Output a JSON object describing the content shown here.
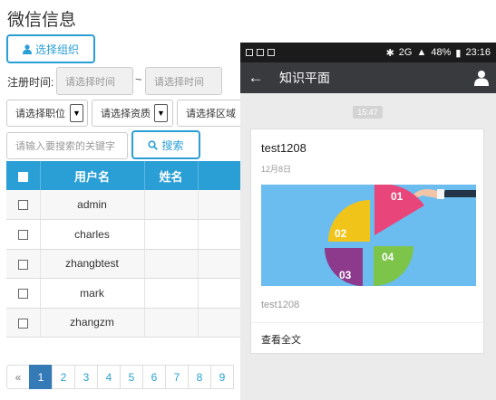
{
  "page": {
    "title": "微信信息"
  },
  "toolbar": {
    "select_org_label": "选择组织",
    "search_label": "搜索"
  },
  "filters": {
    "reg_time_label": "注册时间:",
    "start_placeholder": "请选择时间",
    "range_separator": "~",
    "end_placeholder": "请选择时间",
    "position_select": "请选择职位",
    "qualification_select": "请选择资质",
    "region_select": "请选择区域",
    "keyword_placeholder": "请输入要搜索的关键字"
  },
  "table": {
    "headers": [
      "",
      "用户名",
      "姓名",
      ""
    ],
    "rows": [
      {
        "username": "admin",
        "name": ""
      },
      {
        "username": "charles",
        "name": ""
      },
      {
        "username": "zhangbtest",
        "name": ""
      },
      {
        "username": "mark",
        "name": ""
      },
      {
        "username": "zhangzm",
        "name": ""
      }
    ]
  },
  "pagination": {
    "prev": "«",
    "pages": [
      "1",
      "2",
      "3",
      "4",
      "5",
      "6",
      "7",
      "8",
      "9"
    ],
    "active": "1"
  },
  "phone": {
    "status_bar": {
      "battery": "48%",
      "time": "23:16",
      "network": "2G"
    },
    "nav_title": "知识平面",
    "message_time": "15:47",
    "card": {
      "title": "test1208",
      "date": "12月8日",
      "image_labels": [
        "01",
        "02",
        "03",
        "04"
      ],
      "description": "test1208",
      "read_more": "查看全文"
    }
  },
  "colors": {
    "accent": "#2a9fd6",
    "pager_active": "#337ab7",
    "navbar": "#393a3e"
  }
}
